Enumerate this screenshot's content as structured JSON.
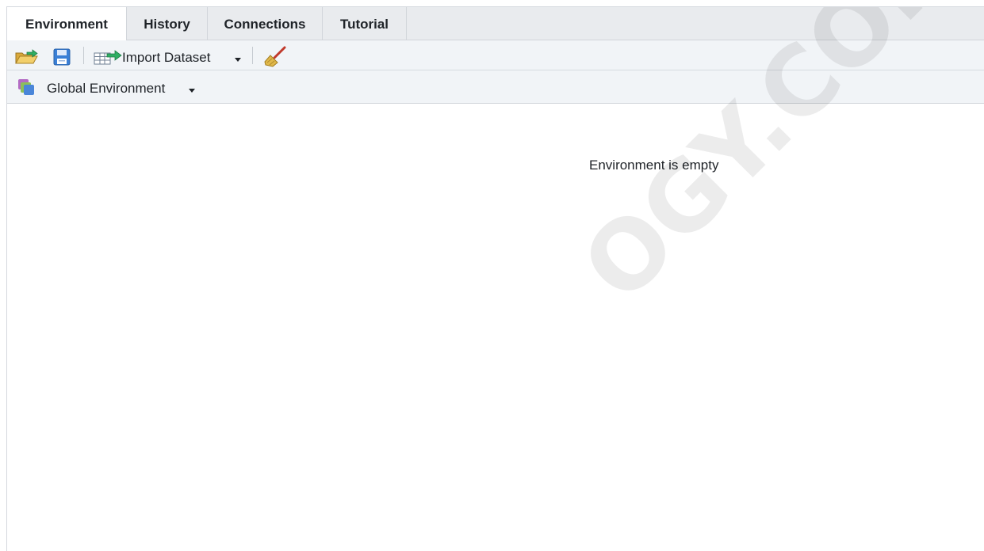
{
  "tabs": [
    {
      "label": "Environment",
      "active": true
    },
    {
      "label": "History",
      "active": false
    },
    {
      "label": "Connections",
      "active": false
    },
    {
      "label": "Tutorial",
      "active": false
    }
  ],
  "toolbar": {
    "open_icon": "folder-open-icon",
    "save_icon": "save-icon",
    "import_icon": "import-dataset-icon",
    "import_label": "Import Dataset",
    "clear_icon": "broom-icon"
  },
  "environment_selector": {
    "icon": "environment-stack-icon",
    "label": "Global Environment"
  },
  "main": {
    "empty_message": "Environment is empty"
  },
  "watermark": {
    "text": "OGY.COM"
  },
  "colors": {
    "tab_bar_bg": "#e9ebee",
    "toolbar_bg": "#f1f4f7",
    "active_tab_bg": "#ffffff"
  }
}
